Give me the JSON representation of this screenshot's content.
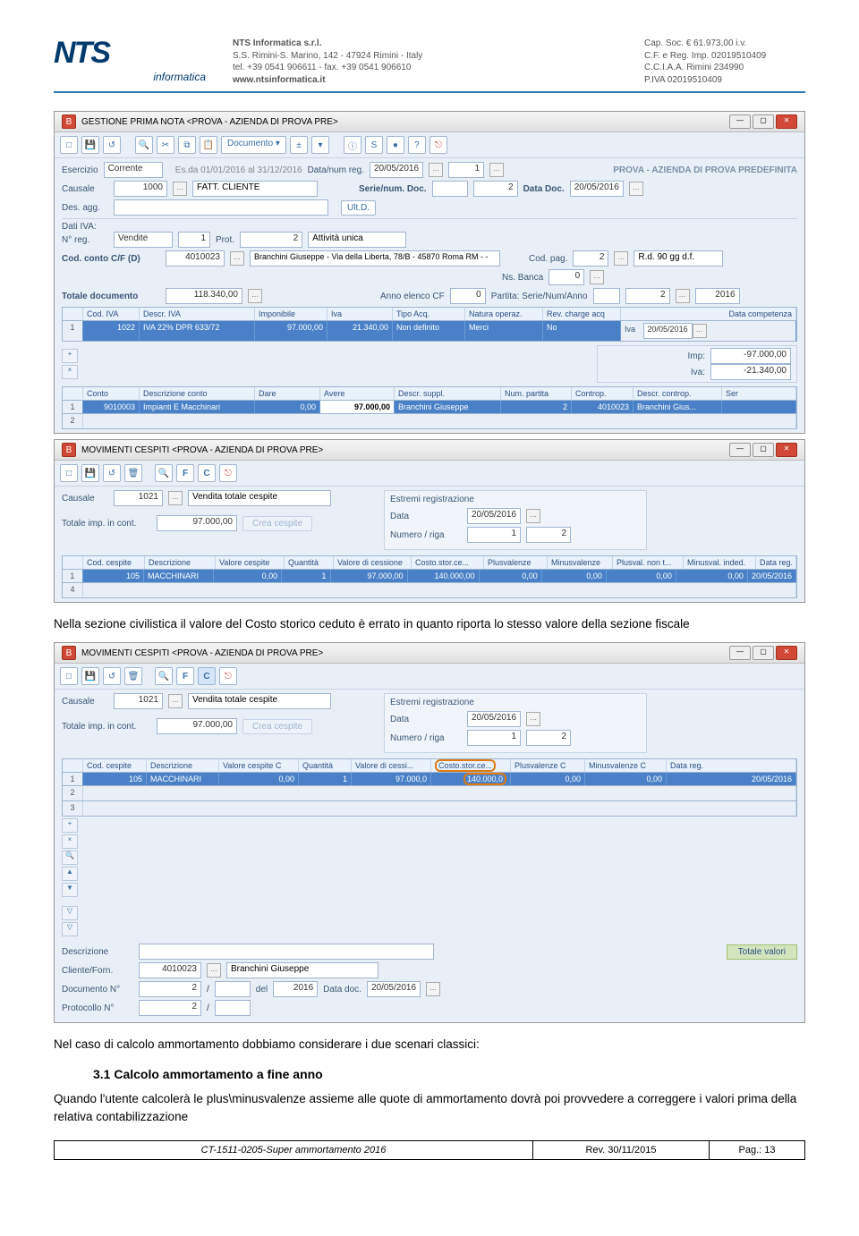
{
  "header": {
    "logo_main": "NTS",
    "logo_sub": "informatica",
    "col1_line1": "NTS Informatica s.r.l.",
    "col1_line2": "S.S. Rimini-S. Marino, 142 - 47924 Rimini - Italy",
    "col1_line3": "tel. +39 0541 906611 - fax. +39 0541 906610",
    "col1_line4": "www.ntsinformatica.it",
    "col2_line1": "Cap. Soc. € 61.973,00 i.v.",
    "col2_line2": "C.F. e Reg. Imp. 02019510409",
    "col2_line3": "C.C.I.A.A. Rimini 234990",
    "col2_line4": "P.IVA 02019510409"
  },
  "win1": {
    "title": "GESTIONE PRIMA NOTA <PROVA - AZIENDA DI PROVA PRE>",
    "docbtn": "Documento",
    "row1": {
      "esercizio_lbl": "Esercizio",
      "esercizio_val": "Corrente",
      "esda_lbl": "Es.da 01/01/2016 al 31/12/2016",
      "datanum_lbl": "Data/num reg.",
      "datanum_val": "20/05/2016",
      "num": "1",
      "title_right": "PROVA - AZIENDA DI PROVA PREDEFINITA"
    },
    "row2": {
      "causale_lbl": "Causale",
      "causale_cod": "1000",
      "causale_desc": "FATT. CLIENTE",
      "serie_lbl": "Serie/num. Doc.",
      "serie_num": "2",
      "datadoc_lbl": "Data Doc.",
      "datadoc_val": "20/05/2016"
    },
    "row3": {
      "des_lbl": "Des. agg.",
      "ultd": "Ult.D."
    },
    "dati_iva_lbl": "Dati IVA:",
    "row4": {
      "nreg_lbl": "N° reg.",
      "nreg_val": "Vendite",
      "nreg_n": "1",
      "prot_lbl": "Prot.",
      "prot_n": "2",
      "att_lbl": "Attività unica"
    },
    "row5": {
      "codcf_lbl": "Cod. conto C/F (D)",
      "codcf_val": "4010023",
      "codcf_desc": "Branchini Giuseppe  - Via della Liberta, 78/B - 45870 Roma RM -  -",
      "cp_lbl": "Cod. pag.",
      "cp_val": "2",
      "cp_desc": "R.d. 90 gg d.f.",
      "nsb_lbl": "Ns. Banca",
      "nsb_val": "0"
    },
    "row6": {
      "tot_lbl": "Totale documento",
      "tot_val": "118.340,00",
      "ae_lbl": "Anno elenco CF",
      "ae_val": "0",
      "part_lbl": "Partita: Serie/Num/Anno",
      "p_s": "",
      "p_n": "2",
      "p_a": "2016"
    },
    "grid1": {
      "h": [
        "",
        "Cod. IVA",
        "Descr. IVA",
        "Imponibile",
        "Iva",
        "Tipo Acq.",
        "Natura operaz.",
        "Rev. charge acq",
        "",
        "Data competenza"
      ],
      "extra_lbl_iva": "Iva",
      "extra_iva_date": "20/05/2016",
      "row": [
        "",
        "1022",
        "IVA 22% DPR 633/72",
        "97.000,00",
        "21.340,00",
        "Non definito",
        "Merci",
        "No",
        "",
        ""
      ]
    },
    "tot_box": {
      "imp_lbl": "Imp:",
      "imp_val": "-97.000,00",
      "iva_lbl": "Iva:",
      "iva_val": "-21.340,00"
    },
    "grid2": {
      "h": [
        "",
        "Conto",
        "Descrizione conto",
        "Dare",
        "Avere",
        "Descr. suppl.",
        "Num. partita",
        "Controp.",
        "Descr. controp.",
        "Ser"
      ],
      "row": [
        "",
        "9010003",
        "Impianti E Macchinari",
        "0,00",
        "97.000,00",
        "Branchini Giuseppe",
        "2",
        "4010023",
        "Branchini Gius...",
        ""
      ]
    }
  },
  "win2": {
    "title": "MOVIMENTI CESPITI <PROVA - AZIENDA DI PROVA PRE>",
    "causale_lbl": "Causale",
    "causale_cod": "1021",
    "causale_desc": "Vendita totale cespite",
    "tot_lbl": "Totale imp. in cont.",
    "tot_val": "97.000,00",
    "crea": "Crea cespite",
    "er_lbl": "Estremi registrazione",
    "data_lbl": "Data",
    "data_val": "20/05/2016",
    "nr_lbl": "Numero / riga",
    "nr_n": "1",
    "nr_r": "2",
    "grid": {
      "h": [
        "",
        "Cod. cespite",
        "Descrizione",
        "Valore cespite",
        "Quantità",
        "Valore di cessione",
        "Costo.stor.ce...",
        "Plusvalenze",
        "Minusvalenze",
        "Plusval. non t...",
        "Minusval. inded.",
        "Data reg."
      ],
      "row": [
        "",
        "105",
        "MACCHINARI",
        "0,00",
        "1",
        "97.000,00",
        "140.000,00",
        "0,00",
        "0,00",
        "0,00",
        "0,00",
        "20/05/2016"
      ]
    }
  },
  "para1": "Nella sezione civilistica il valore del Costo storico ceduto è errato in quanto riporta lo stesso valore della sezione fiscale",
  "win3": {
    "title": "MOVIMENTI CESPITI <PROVA - AZIENDA DI PROVA PRE>",
    "causale_lbl": "Causale",
    "causale_cod": "1021",
    "causale_desc": "Vendita totale cespite",
    "tot_lbl": "Totale imp. in cont.",
    "tot_val": "97.000,00",
    "crea": "Crea cespite",
    "er_lbl": "Estremi registrazione",
    "data_lbl": "Data",
    "data_val": "20/05/2016",
    "nr_lbl": "Numero / riga",
    "nr_n": "1",
    "nr_r": "2",
    "grid": {
      "h": [
        "",
        "Cod. cespite",
        "Descrizione",
        "Valore cespite C",
        "Quantità",
        "Valore di cessi...",
        "Costo.stor.ce...",
        "Plusvalenze C",
        "Minusvalenze C",
        "Data reg."
      ],
      "row": [
        "",
        "105",
        "MACCHINARI",
        "0,00",
        "1",
        "97.000,0",
        "140.000,0",
        "0,00",
        "0,00",
        "20/05/2016"
      ]
    },
    "detail": {
      "d_lbl": "Descrizione",
      "cf_lbl": "Cliente/Forn.",
      "cf_cod": "4010023",
      "cf_desc": "Branchini Giuseppe",
      "doc_lbl": "Documento N°",
      "doc_n": "2",
      "sl": "/",
      "del": "del",
      "anno": "2016",
      "dd_lbl": "Data doc.",
      "dd_val": "20/05/2016",
      "prot_lbl": "Protocollo N°",
      "prot_n": "2",
      "totv": "Totale valori"
    }
  },
  "para2": "Nel caso di calcolo ammortamento dobbiamo considerare i due scenari classici:",
  "h3": "3.1 Calcolo ammortamento a fine anno",
  "para3": "Quando l'utente calcolerà le plus\\minusvalenze assieme alle quote di ammortamento dovrà poi provvedere a correggere i valori prima della relativa contabilizzazione",
  "footer": {
    "c1": "CT-1511-0205-Super ammortamento 2016",
    "c2": "Rev. 30/11/2015",
    "c3": "Pag.: 13"
  }
}
